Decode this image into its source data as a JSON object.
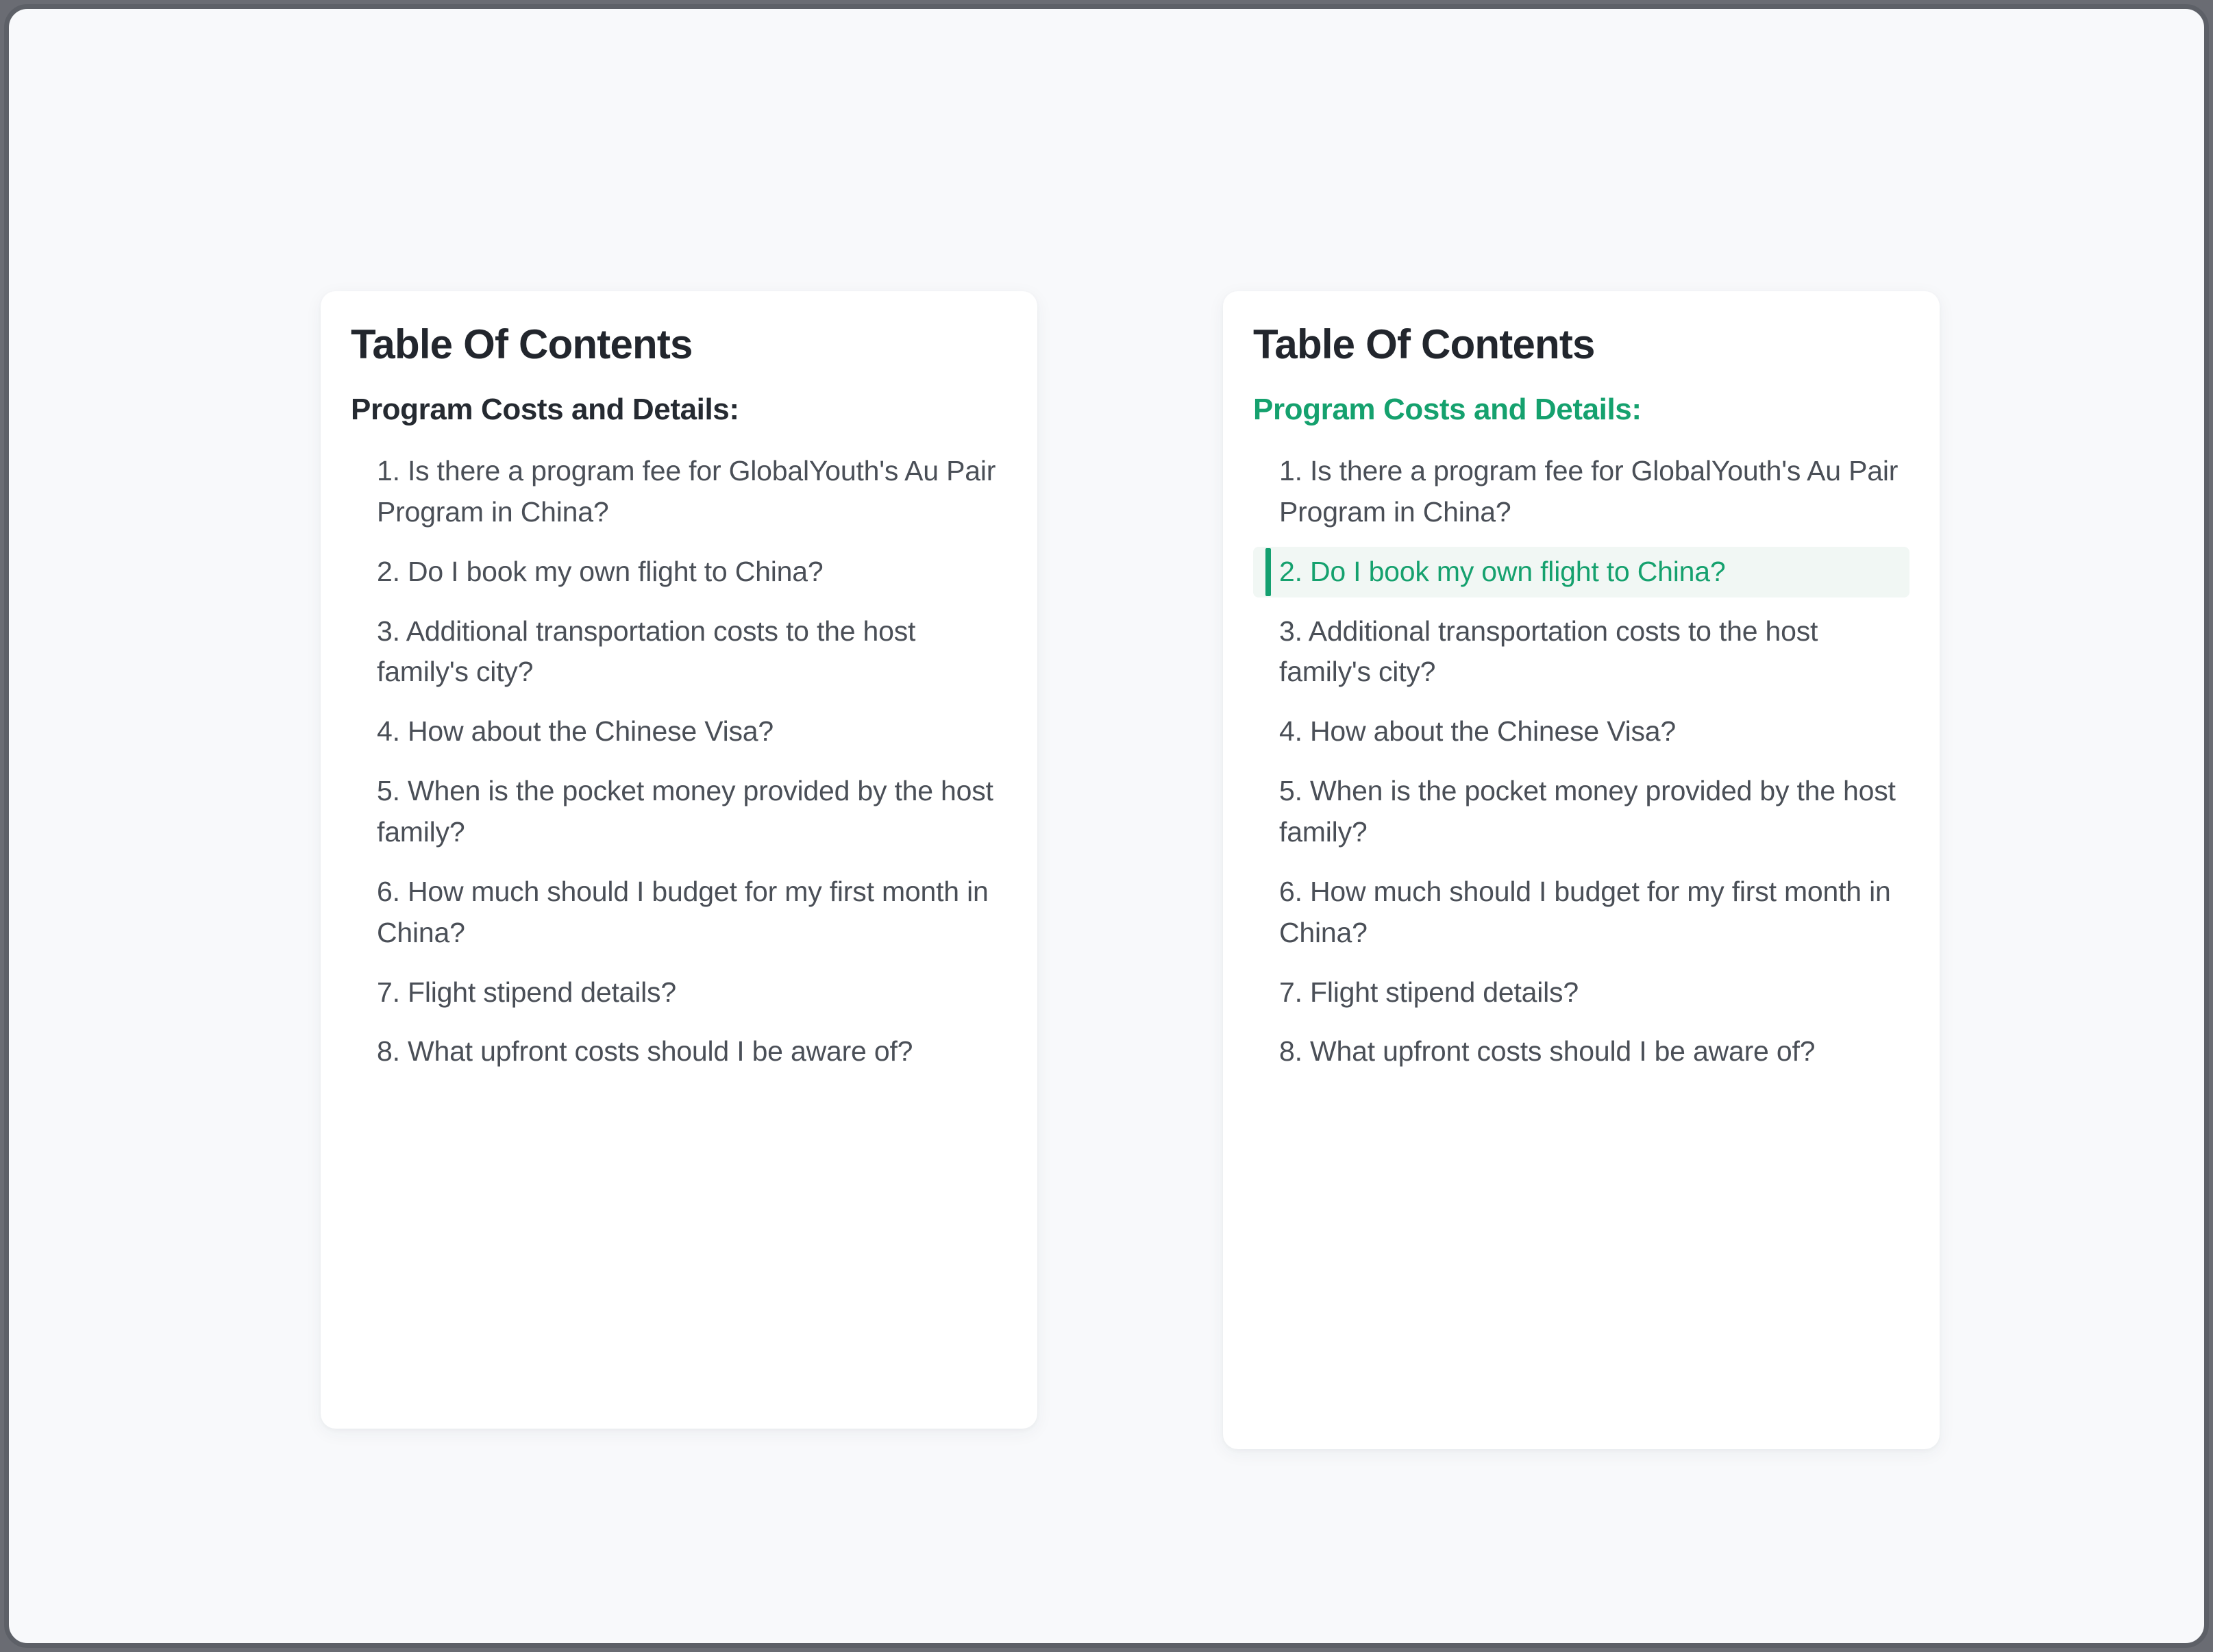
{
  "panels": [
    {
      "name": "plain-panel",
      "title": "Table Of Contents",
      "section_heading": "Program Costs and Details:",
      "section_heading_color": "#252a31",
      "active_index": -1,
      "items": [
        "1. Is there a program fee for GlobalYouth's Au Pair Program in China?",
        "2. Do I book my own flight to China?",
        "3. Additional transportation costs to the host family's city?",
        "4. How about the Chinese Visa?",
        "5. When is the pocket money provided by the host family?",
        "6. How much should I budget for my first month in China?",
        "7. Flight stipend details?",
        "8. What upfront costs should I be aware of?"
      ]
    },
    {
      "name": "highlighted-panel",
      "title": "Table Of Contents",
      "section_heading": "Program Costs and Details:",
      "section_heading_color": "#15a16e",
      "active_index": 1,
      "items": [
        "1. Is there a program fee for GlobalYouth's Au Pair Program in China?",
        "2. Do I book my own flight to China?",
        "3. Additional transportation costs to the host family's city?",
        "4. How about the Chinese Visa?",
        "5. When is the pocket money provided by the host family?",
        "6. How much should I budget for my first month in China?",
        "7. Flight stipend details?",
        "8. What upfront costs should I be aware of?"
      ]
    }
  ],
  "colors": {
    "page_background": "#f8f9fb",
    "frame_border": "#5d6067",
    "card_background": "#ffffff",
    "title_text": "#22262d",
    "item_text": "#4a4f57",
    "accent_green": "#15a16e",
    "active_bar": "#14a070",
    "active_row_background": "#f1f7f4"
  }
}
